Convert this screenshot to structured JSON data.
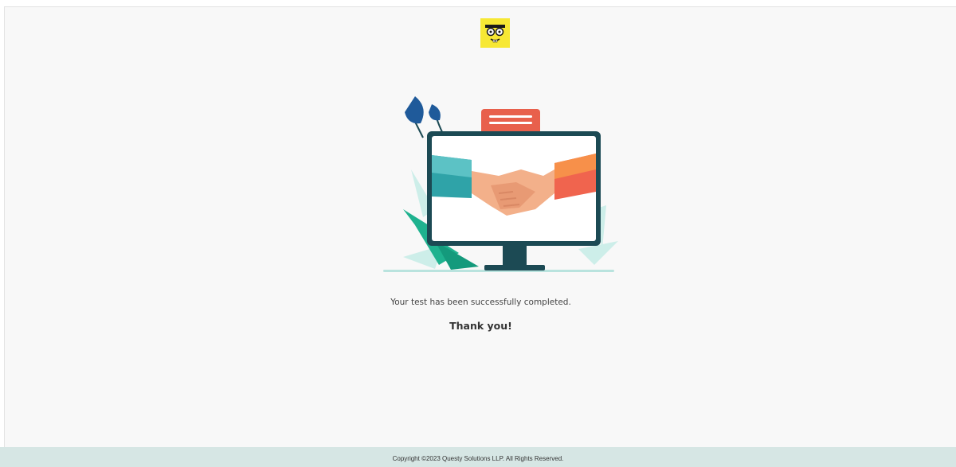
{
  "logo": {
    "icon": "cartoon-face-logo-icon",
    "color": "#f7e834"
  },
  "illustration": {
    "icon": "handshake-monitor-illustration"
  },
  "main": {
    "message": "Your test has been successfully completed.",
    "thanks": "Thank you!"
  },
  "footer": {
    "copyright": "Copyright ©2023 Questy Solutions LLP. All Rights Reserved."
  },
  "colors": {
    "background": "#f8f8f8",
    "footer_bg": "#d6e6e4",
    "monitor": "#1c4a54",
    "sleeve_left": "#2fa3a8",
    "sleeve_right": "#f0644e"
  }
}
